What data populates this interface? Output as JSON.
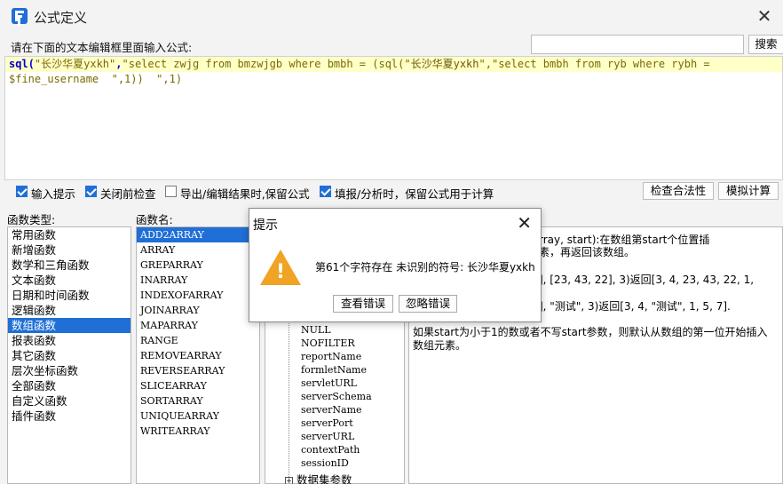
{
  "window": {
    "title": "公式定义",
    "close_icon": "✕"
  },
  "toolbar": {
    "prompt": "请在下面的文本编辑框里面输入公式:",
    "search_value": "",
    "search_button": "搜索"
  },
  "editor": {
    "line1": {
      "p1": "sql(",
      "p2": "\"长沙华夏yxkh\"",
      "p3": ",",
      "p4": "\"select zwjg from bmzwjgb where bmbh = (sql(\"",
      "p5": "长沙华夏yxkh",
      "p6": "\",\"",
      "p7": "select bmbh from ryb where rybh = ",
      "p8": ""
    },
    "line2": {
      "p1": "$fine_username",
      "p2": "  \",1))  \",1)"
    }
  },
  "options": {
    "input_hint": "输入提示",
    "check_on_close": "关闭前检查",
    "keep_formula_export": "导出/编辑结果时,保留公式",
    "keep_formula_fill": "填报/分析时，保留公式用于计算",
    "check_validity": "检查合法性",
    "simulate": "模拟计算"
  },
  "columns": {
    "func_types_title": "函数类型:",
    "func_names_title": "函数名:"
  },
  "func_types": [
    "常用函数",
    "新增函数",
    "数学和三角函数",
    "文本函数",
    "日期和时间函数",
    "逻辑函数",
    "数组函数",
    "报表函数",
    "其它函数",
    "层次坐标函数",
    "全部函数",
    "自定义函数",
    "插件函数"
  ],
  "func_names": [
    "ADD2ARRAY",
    "ARRAY",
    "GREPARRAY",
    "INARRAY",
    "INDEXOFARRAY",
    "JOINARRAY",
    "MAPARRAY",
    "RANGE",
    "REMOVEARRAY",
    "REVERSEARRAY",
    "SLICEARRAY",
    "SORTARRAY",
    "UNIQUEARRAY",
    "WRITEARRAY"
  ],
  "tree": {
    "nodes": [
      "NULL",
      "NOFILTER",
      "reportName",
      "formletName",
      "servletURL",
      "serverSchema",
      "serverName",
      "serverPort",
      "serverURL",
      "contextPath",
      "sessionID"
    ],
    "group": "数据集参数"
  },
  "desc": {
    "l1": "rray, start):在数组第start个位置插",
    "l2": "素，再返回该数组。",
    "l3": "], [23, 43, 22], 3)返回[3, 4, 23, 43, 22, 1,",
    "l4": "], \"测试\", 3)返回[3, 4, \"测试\", 1, 5, 7].",
    "l5": "如果start为小于1的数或者不写start参数，则默认从数组的第一位开始插入",
    "l6": "数组元素。"
  },
  "dialog": {
    "title": "提示",
    "message": "第61个字符存在 未识别的符号: 长沙华夏yxkh",
    "view_error": "查看错误",
    "ignore_error": "忽略错误"
  },
  "colors": {
    "accent": "#1f6fd6",
    "warning": "#f0a324",
    "editor_highlight": "#ffffc8"
  }
}
